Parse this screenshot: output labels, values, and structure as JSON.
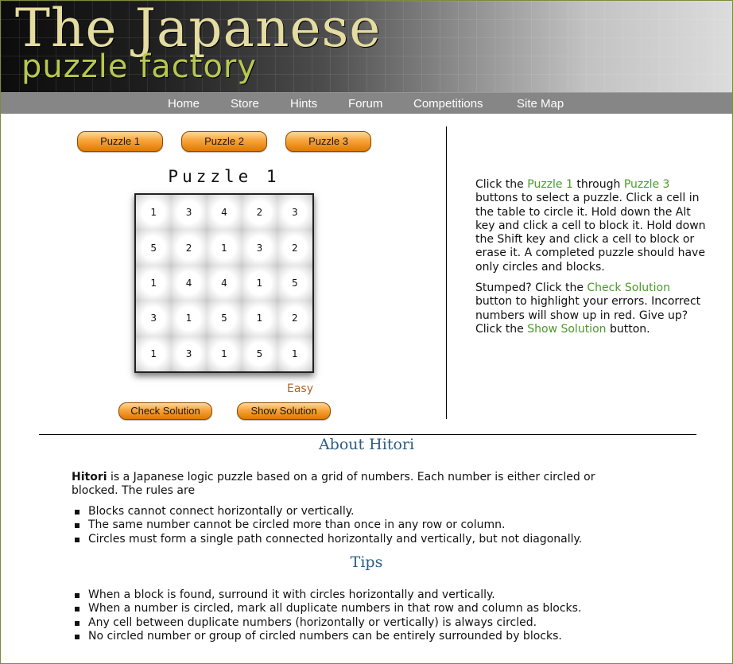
{
  "banner": {
    "title": "The Japanese",
    "subtitle": "puzzle factory"
  },
  "nav": {
    "items": [
      "Home",
      "Store",
      "Hints",
      "Forum",
      "Competitions",
      "Site Map"
    ]
  },
  "puzzle_buttons": [
    "Puzzle 1",
    "Puzzle 2",
    "Puzzle 3"
  ],
  "puzzle": {
    "title": "Puzzle 1",
    "grid": [
      [
        "1",
        "3",
        "4",
        "2",
        "3"
      ],
      [
        "5",
        "2",
        "1",
        "3",
        "2"
      ],
      [
        "1",
        "4",
        "4",
        "1",
        "5"
      ],
      [
        "3",
        "1",
        "5",
        "1",
        "2"
      ],
      [
        "1",
        "3",
        "1",
        "5",
        "1"
      ]
    ],
    "difficulty": "Easy"
  },
  "actions": {
    "check": "Check Solution",
    "show": "Show Solution"
  },
  "instructions": {
    "p1_a": "Click the ",
    "p1_link1": "Puzzle 1",
    "p1_b": " through ",
    "p1_link2": "Puzzle 3",
    "p1_c": " buttons to select a puzzle. Click a cell in the table to circle it. Hold down the Alt key and click a cell to block it. Hold down the Shift key and click a cell to block or erase it. A completed puzzle should have only circles and blocks.",
    "p2_a": "Stumped? Click the ",
    "p2_link1": "Check Solution",
    "p2_b": " button to highlight your errors. Incorrect numbers will show up in red. Give up? Click the ",
    "p2_link2": "Show Solution",
    "p2_c": " button."
  },
  "about": {
    "heading": "About Hitori",
    "intro_bold": "Hitori",
    "intro_rest": " is a Japanese logic puzzle based on a grid of numbers. Each number is either circled or blocked. The rules are",
    "rules": [
      "Blocks cannot connect horizontally or vertically.",
      "The same number cannot be circled more than once in any row or column.",
      "Circles must form a single path connected horizontally and vertically, but not diagonally."
    ]
  },
  "tips": {
    "heading": "Tips",
    "items": [
      "When a block is found, surround it with circles horizontally and vertically.",
      "When a number is circled, mark all duplicate numbers in that row and column as blocks.",
      "Any cell between duplicate numbers (horizontally or vertically) is always circled.",
      "No circled number or group of circled numbers can be entirely surrounded by blocks."
    ]
  },
  "colors": {
    "accent_link": "#4a9a2a",
    "heading": "#2d5d83",
    "difficulty": "#b0622a",
    "button": "#f7a33a",
    "nav_bg": "#868686"
  }
}
